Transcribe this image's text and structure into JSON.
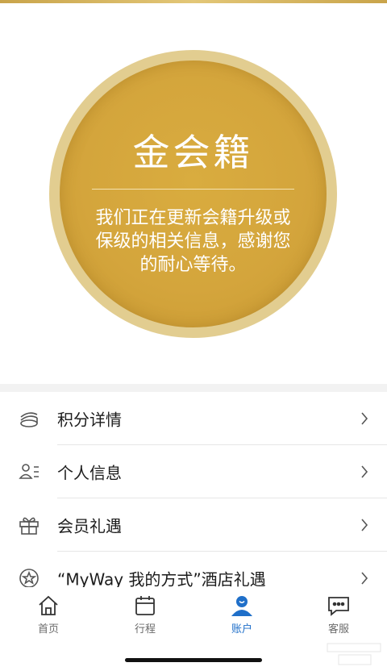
{
  "badge": {
    "title": "金会籍",
    "description": "我们正在更新会籍升级或保级的相关信息，感谢您的耐心等待。"
  },
  "menu": {
    "items": [
      {
        "label": "积分详情",
        "icon": "coins-stack-icon"
      },
      {
        "label": "个人信息",
        "icon": "profile-card-icon"
      },
      {
        "label": "会员礼遇",
        "icon": "gift-icon"
      },
      {
        "label": "“MyWay 我的方式”酒店礼遇",
        "icon": "star-badge-icon"
      }
    ]
  },
  "tabbar": {
    "tabs": [
      {
        "label": "首页",
        "icon": "home-icon"
      },
      {
        "label": "行程",
        "icon": "calendar-icon"
      },
      {
        "label": "账户",
        "icon": "account-icon"
      },
      {
        "label": "客服",
        "icon": "chat-icon"
      }
    ],
    "active": "账户"
  },
  "colors": {
    "gold": "#d4a53c",
    "gold_ring": "#e2cd90",
    "active_tab": "#1f6fc9"
  }
}
